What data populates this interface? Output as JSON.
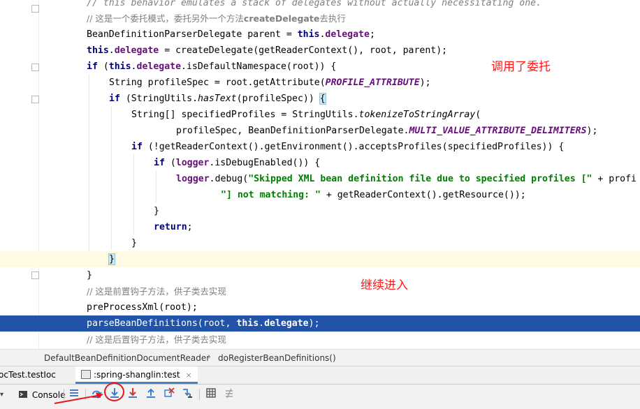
{
  "editor": {
    "lines": [
      {
        "kind": "comment",
        "text": "// this behavior emulates a stack of delegates without actually necessitating one."
      },
      {
        "kind": "comment-zh",
        "prefix": "// 这是一个委托模式，委托另外一个方法",
        "method": "createDelegate",
        "suffix": "去执行"
      },
      {
        "kind": "code",
        "a": "BeanDefinitionParserDelegate parent = ",
        "kw": "this",
        "dot": ".",
        "field": "delegate",
        "end": ";"
      },
      {
        "kind": "code",
        "kw": "this",
        "dot": ".",
        "field": "delegate",
        "rest": " = createDelegate(getReaderContext(), root, parent);"
      },
      {
        "kind": "code",
        "kw1": "if",
        "a": " (",
        "kw2": "this",
        "dot": ".",
        "field": "delegate",
        "rest": ".isDefaultNamespace(root)) {"
      },
      {
        "kind": "code",
        "a": "String profileSpec = root.getAttribute(",
        "const": "PROFILE_ATTRIBUTE",
        "end": ");"
      },
      {
        "kind": "code",
        "kw": "if",
        "a": " (StringUtils.",
        "method": "hasText",
        "b": "(profileSpec)) ",
        "brace": "{"
      },
      {
        "kind": "code",
        "a": "String[] specifiedProfiles = StringUtils.",
        "method": "tokenizeToStringArray",
        "end": "("
      },
      {
        "kind": "code",
        "a": "profileSpec, BeanDefinitionParserDelegate.",
        "const": "MULTI_VALUE_ATTRIBUTE_DELIMITERS",
        "end": ");"
      },
      {
        "kind": "code",
        "kw": "if",
        "rest": " (!getReaderContext().getEnvironment().acceptsProfiles(specifiedProfiles)) {"
      },
      {
        "kind": "code",
        "kw": "if",
        "a": " (",
        "field": "logger",
        "rest": ".isDebugEnabled()) {"
      },
      {
        "kind": "code",
        "field": "logger",
        "a": ".debug(",
        "str": "\"Skipped XML bean definition file due to specified profiles [\"",
        "rest": " + profi"
      },
      {
        "kind": "code",
        "str": "\"] not matching: \"",
        "rest": " + getReaderContext().getResource());"
      },
      {
        "kind": "code",
        "text": "}"
      },
      {
        "kind": "code",
        "kw": "return",
        "end": ";"
      },
      {
        "kind": "code",
        "text": "}"
      },
      {
        "kind": "code",
        "brace": "}"
      },
      {
        "kind": "code",
        "text": "}"
      },
      {
        "kind": "comment-zh",
        "prefix": "// 这是前置钩子方法，供子类去实现"
      },
      {
        "kind": "code",
        "text": "preProcessXml(root);"
      },
      {
        "kind": "code",
        "a": "parseBeanDefinitions(root, ",
        "kw": "this",
        "dot": ".",
        "field": "delegate",
        "end": ");"
      },
      {
        "kind": "comment-zh",
        "prefix": "// 这是后置钩子方法，供子类去实现"
      }
    ],
    "annotations": {
      "delegate_note": "调用了委托",
      "continue_note": "继续进入"
    }
  },
  "breadcrumb": {
    "class_name": "DefaultBeanDefinitionDocumentReader",
    "separator": "›",
    "method_name": "doRegisterBeanDefinitions()"
  },
  "debug_tabs": [
    {
      "label": "ocTest.testIoc",
      "active": false
    },
    {
      "label": ":spring-shanglin:test",
      "active": true,
      "close": "×"
    }
  ],
  "toolbar": {
    "console_label": "Console",
    "icons": [
      "console-icon",
      "show-execution-point-icon",
      "step-over-icon",
      "step-into-icon",
      "force-step-into-icon",
      "step-out-icon",
      "drop-frame-icon",
      "run-to-cursor-icon",
      "evaluate-expression-icon",
      "trace-icon"
    ]
  },
  "colors": {
    "keyword": "#000080",
    "field": "#660e7a",
    "string": "#008000",
    "comment": "#808080",
    "current_line": "#2154a8",
    "annotation": "#ff1a1a"
  }
}
